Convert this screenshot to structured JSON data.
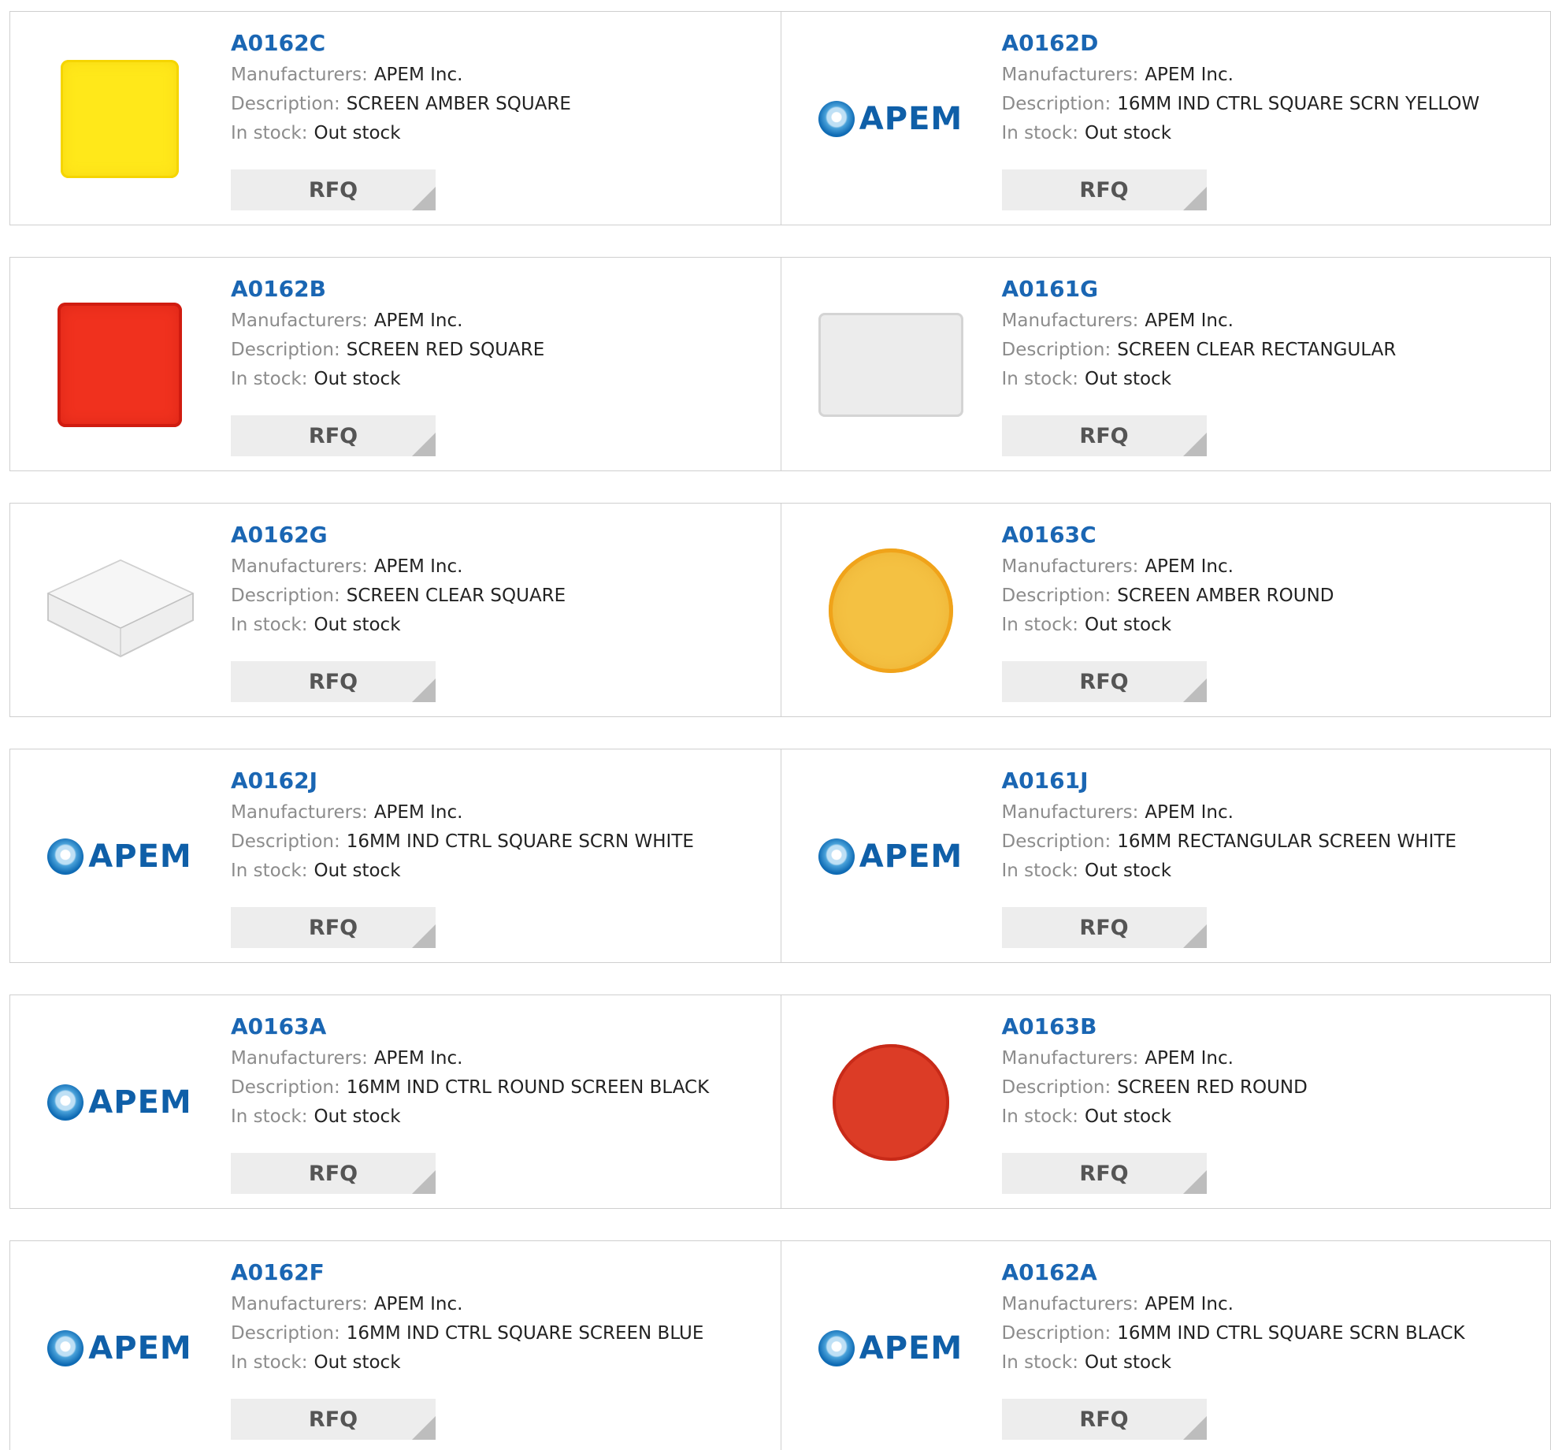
{
  "labels": {
    "manufacturers": "Manufacturers:",
    "description": "Description:",
    "in_stock": "In stock:",
    "rfq": "RFQ",
    "logo_text": "APEM"
  },
  "colors": {
    "part_link": "#1a66b3",
    "label": "#8c8c8c",
    "value": "#222222",
    "rfq_bg": "#ededed"
  },
  "products": [
    {
      "part": "A0162C",
      "manufacturer": "APEM Inc.",
      "description": "SCREEN AMBER SQUARE",
      "stock": "Out stock",
      "image": "amber-square"
    },
    {
      "part": "A0162D",
      "manufacturer": "APEM Inc.",
      "description": "16MM IND CTRL SQUARE SCRN YELLOW",
      "stock": "Out stock",
      "image": "apem-logo"
    },
    {
      "part": "A0162B",
      "manufacturer": "APEM Inc.",
      "description": "SCREEN RED SQUARE",
      "stock": "Out stock",
      "image": "red-square"
    },
    {
      "part": "A0161G",
      "manufacturer": "APEM Inc.",
      "description": "SCREEN CLEAR RECTANGULAR",
      "stock": "Out stock",
      "image": "clear-rectangle"
    },
    {
      "part": "A0162G",
      "manufacturer": "APEM Inc.",
      "description": "SCREEN CLEAR SQUARE",
      "stock": "Out stock",
      "image": "clear-square"
    },
    {
      "part": "A0163C",
      "manufacturer": "APEM Inc.",
      "description": "SCREEN AMBER ROUND",
      "stock": "Out stock",
      "image": "amber-round"
    },
    {
      "part": "A0162J",
      "manufacturer": "APEM Inc.",
      "description": "16MM IND CTRL SQUARE SCRN WHITE",
      "stock": "Out stock",
      "image": "apem-logo"
    },
    {
      "part": "A0161J",
      "manufacturer": "APEM Inc.",
      "description": "16MM RECTANGULAR SCREEN WHITE",
      "stock": "Out stock",
      "image": "apem-logo"
    },
    {
      "part": "A0163A",
      "manufacturer": "APEM Inc.",
      "description": "16MM IND CTRL ROUND SCREEN BLACK",
      "stock": "Out stock",
      "image": "apem-logo"
    },
    {
      "part": "A0163B",
      "manufacturer": "APEM Inc.",
      "description": "SCREEN RED ROUND",
      "stock": "Out stock",
      "image": "red-round"
    },
    {
      "part": "A0162F",
      "manufacturer": "APEM Inc.",
      "description": "16MM IND CTRL SQUARE SCREEN BLUE",
      "stock": "Out stock",
      "image": "apem-logo"
    },
    {
      "part": "A0162A",
      "manufacturer": "APEM Inc.",
      "description": "16MM IND CTRL SQUARE SCRN BLACK",
      "stock": "Out stock",
      "image": "apem-logo"
    }
  ]
}
